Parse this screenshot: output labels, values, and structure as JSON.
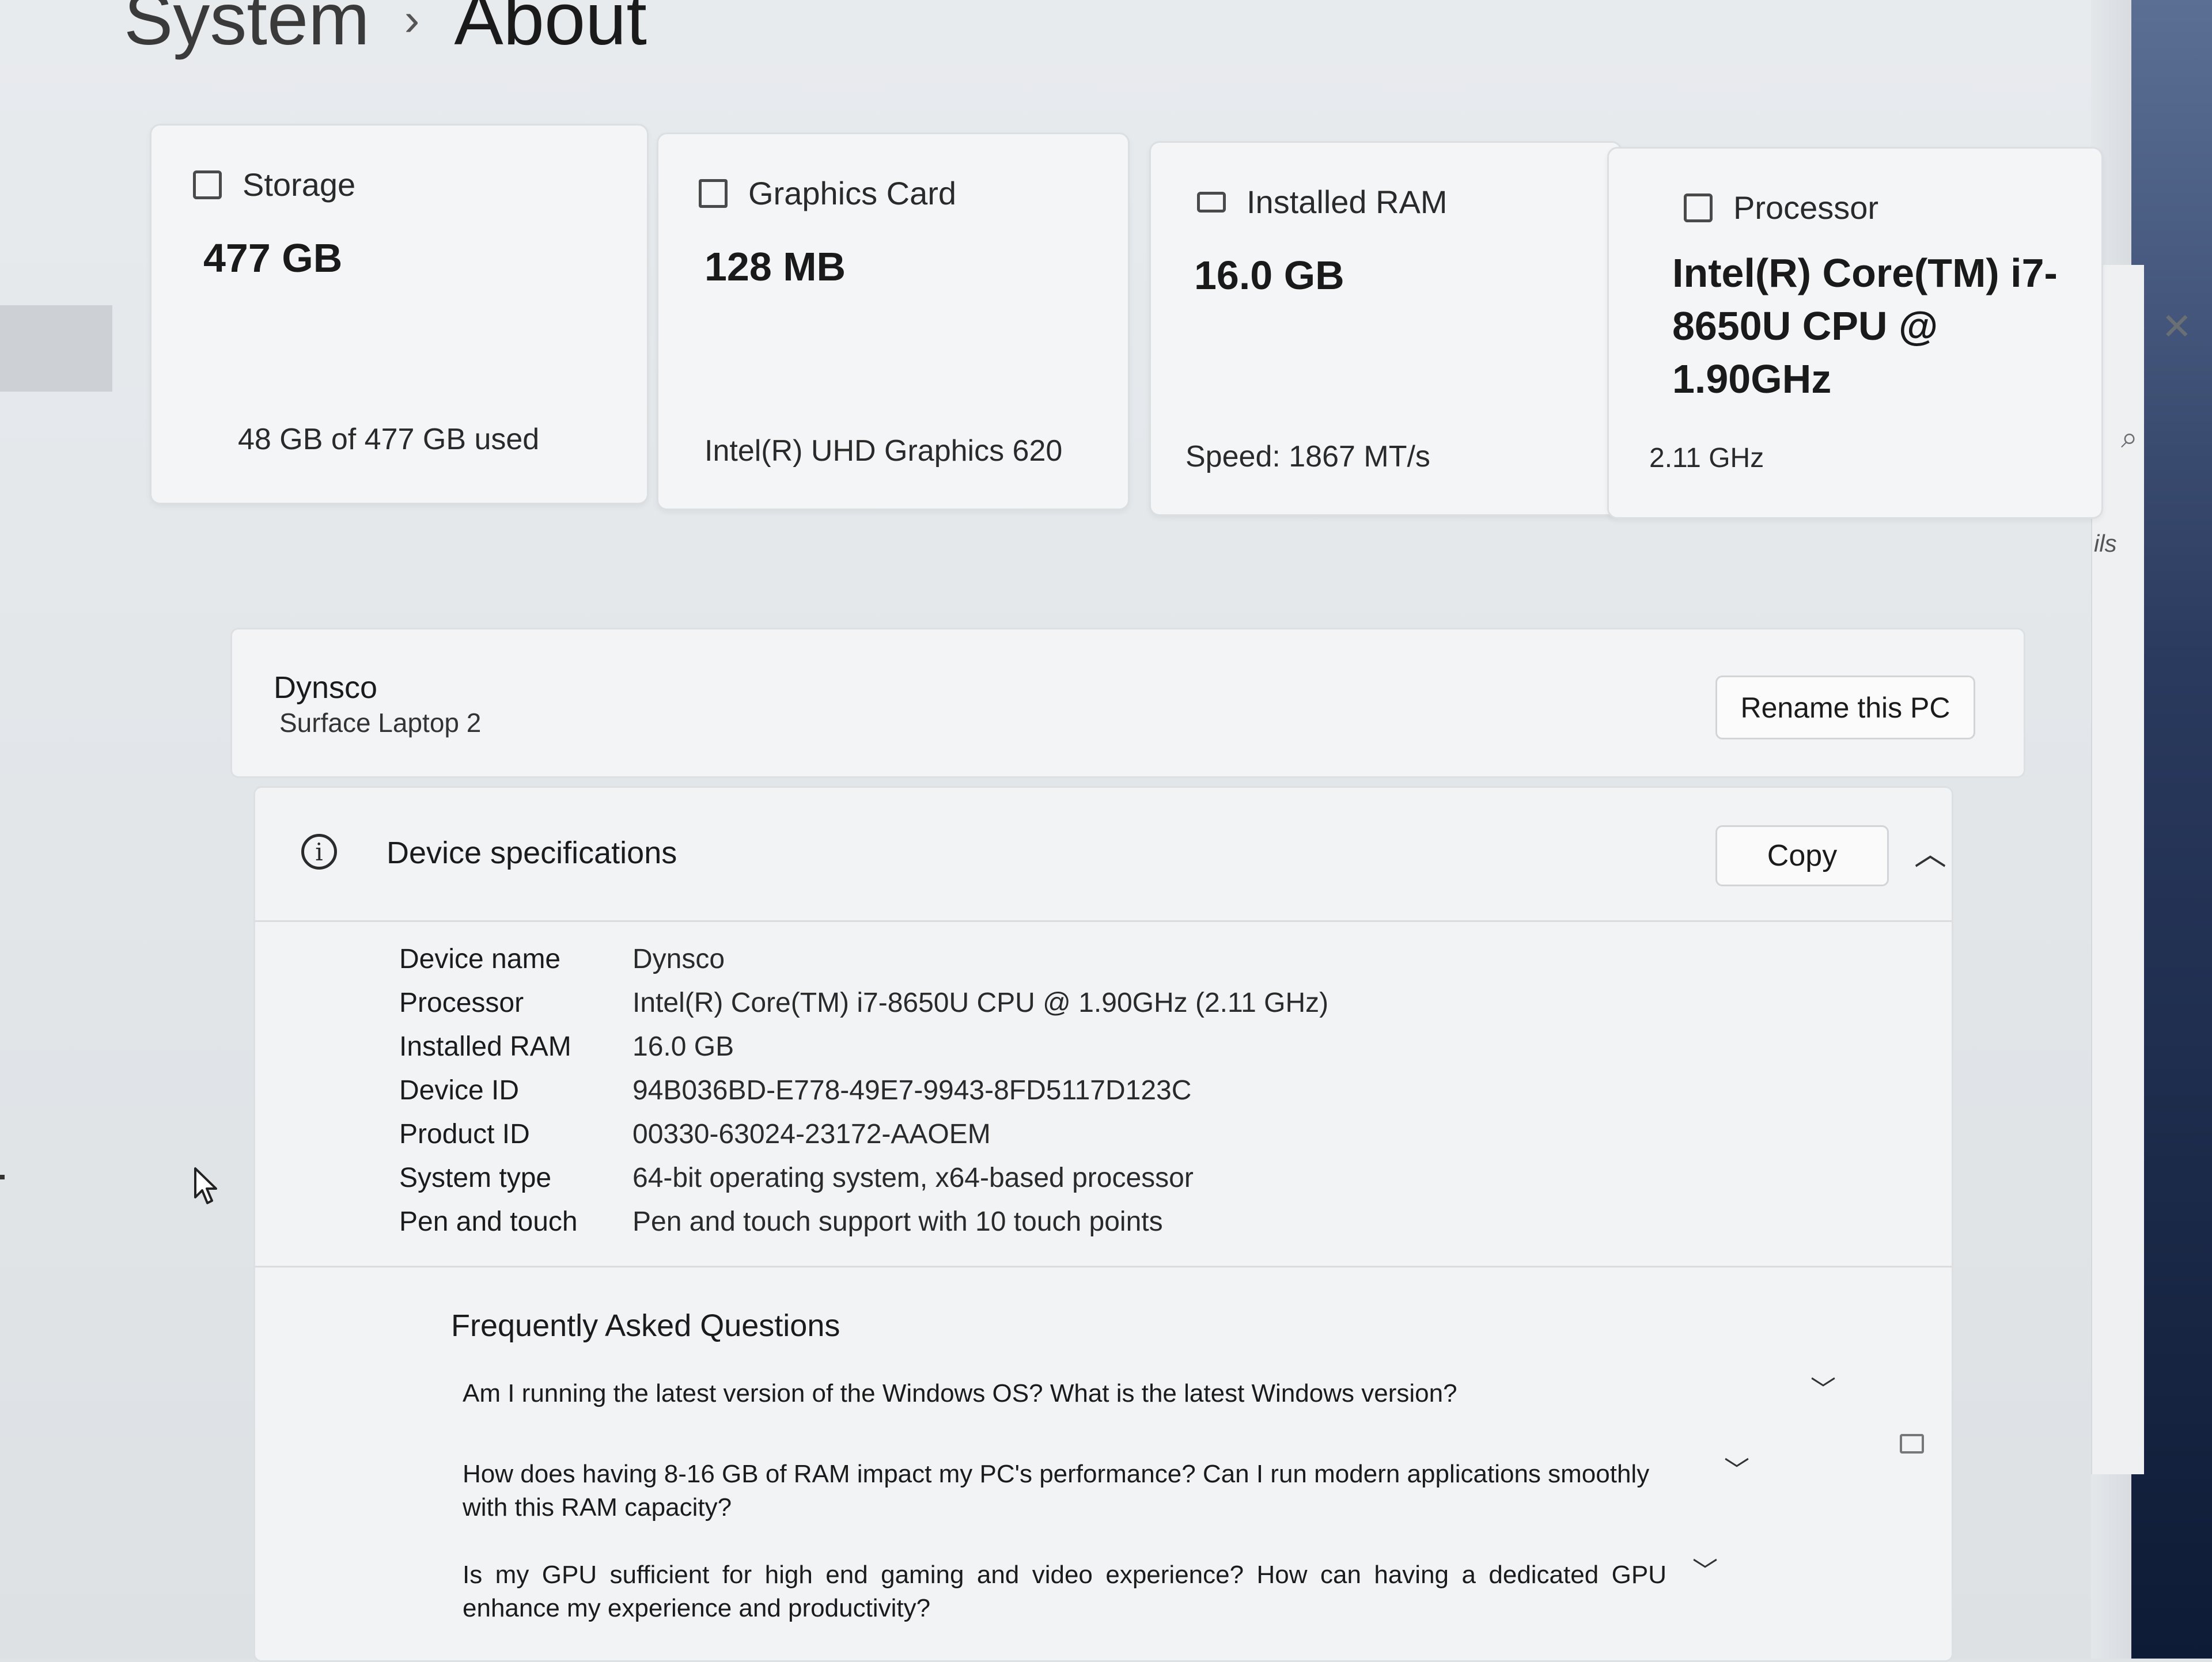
{
  "breadcrumb": {
    "parent": "System",
    "separator": "›",
    "current": "About"
  },
  "cards": {
    "storage": {
      "label": "Storage",
      "value": "477 GB",
      "detail": "48 GB of 477 GB used"
    },
    "graphics": {
      "label": "Graphics Card",
      "value": "128 MB",
      "detail": "Intel(R) UHD Graphics 620"
    },
    "ram": {
      "label": "Installed RAM",
      "value": "16.0 GB",
      "detail": "Speed: 1867 MT/s"
    },
    "processor": {
      "label": "Processor",
      "value": "Intel(R) Core(TM) i7-8650U CPU @ 1.90GHz",
      "detail": "2.11 GHz"
    }
  },
  "pc": {
    "name": "Dynsco",
    "model": "Surface Laptop 2",
    "rename_label": "Rename this PC"
  },
  "specs": {
    "title": "Device specifications",
    "copy_label": "Copy",
    "rows": [
      {
        "key": "Device name",
        "value": "Dynsco"
      },
      {
        "key": "Processor",
        "value": "Intel(R) Core(TM) i7-8650U CPU @ 1.90GHz (2.11 GHz)"
      },
      {
        "key": "Installed RAM",
        "value": "16.0 GB"
      },
      {
        "key": "Device ID",
        "value": "94B036BD-E778-49E7-9943-8FD5117D123C"
      },
      {
        "key": "Product ID",
        "value": "00330-63024-23172-AAOEM"
      },
      {
        "key": "System type",
        "value": "64-bit operating system, x64-based processor"
      },
      {
        "key": "Pen and touch",
        "value": "Pen and touch support with 10 touch points"
      }
    ]
  },
  "faq": {
    "title": "Frequently Asked Questions",
    "items": [
      "Am I running the latest version of the Windows OS? What is the latest Windows version?",
      "How does having 8-16 GB of RAM impact my PC's performance? Can I run modern applications smoothly with this RAM capacity?",
      "Is my GPU sufficient for high end gaming and video experience? How can having a dedicated GPU enhance my experience and productivity?"
    ]
  },
  "side": {
    "partial_text": "ils"
  }
}
